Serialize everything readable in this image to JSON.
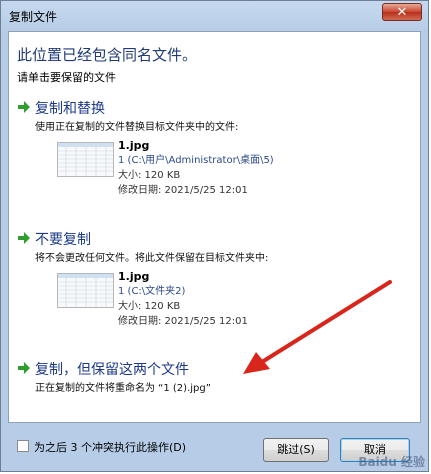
{
  "window": {
    "title": "复制文件",
    "close_glyph": "✕"
  },
  "main": {
    "heading": "此位置已经包含同名文件。",
    "subheading": "请单击要保留的文件"
  },
  "options": {
    "replace": {
      "title": "复制和替换",
      "description": "使用正在复制的文件替换目标文件夹中的文件:",
      "file_name": "1.jpg",
      "file_path": "1 (C:\\用户\\Administrator\\桌面\\5)",
      "file_size": "大小: 120 KB",
      "file_modified": "修改日期: 2021/5/25 12:01"
    },
    "skip": {
      "title": "不要复制",
      "description": "将不会更改任何文件。将此文件保留在目标文件夹中:",
      "file_name": "1.jpg",
      "file_path": "1 (C:\\文件夹2)",
      "file_size": "大小: 120 KB",
      "file_modified": "修改日期: 2021/5/25 12:01"
    },
    "keep_both": {
      "title": "复制，但保留这两个文件",
      "description": "正在复制的文件将重命名为 “1 (2).jpg”"
    }
  },
  "footer": {
    "checkbox_label": "为之后 3 个冲突执行此操作(D)",
    "skip_button": "跳过(S)",
    "cancel_button": "取消"
  },
  "watermark": "Baidu 经验",
  "colors": {
    "accent_blue": "#1d3a8a",
    "arrow_green": "#2f9e2f",
    "annotation_red": "#d8261c"
  }
}
